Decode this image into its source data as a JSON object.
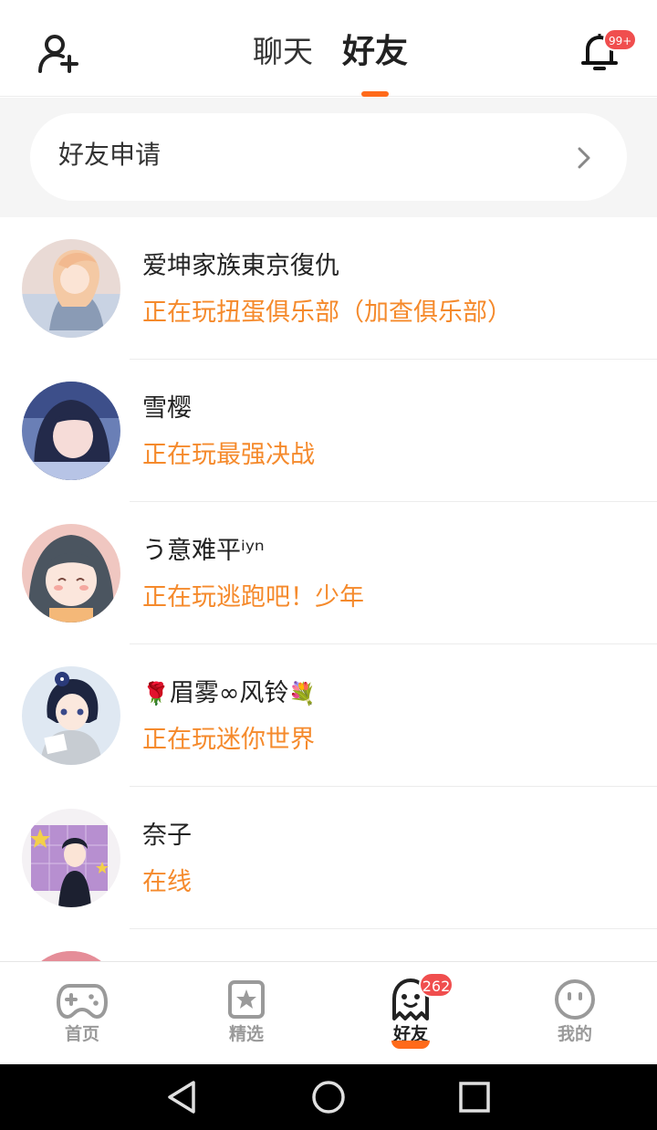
{
  "header": {
    "tabs": [
      {
        "label": "聊天",
        "active": false
      },
      {
        "label": "好友",
        "active": true
      }
    ],
    "notification_badge": "99+",
    "accent_color": "#ff6a1a"
  },
  "friend_request": {
    "label": "好友申请"
  },
  "friends": [
    {
      "name": "爱坤家族東京復仇",
      "status": "正在玩扭蛋俱乐部（加查俱乐部）"
    },
    {
      "name": "雪樱",
      "status": "正在玩最强决战"
    },
    {
      "name": "う意难平ⁱʸⁿ",
      "status": "正在玩逃跑吧！少年"
    },
    {
      "name_prefix_emoji": "🌹",
      "name": "眉雾∞风铃",
      "name_suffix_emoji": "💐",
      "status": "正在玩迷你世界"
    },
    {
      "name": "奈子",
      "status": "在线"
    }
  ],
  "bottom_nav": {
    "items": [
      {
        "label": "首页",
        "icon": "gamepad-icon",
        "active": false
      },
      {
        "label": "精选",
        "icon": "star-bookmark-icon",
        "active": false
      },
      {
        "label": "好友",
        "icon": "ghost-icon",
        "active": true,
        "badge": "262"
      },
      {
        "label": "我的",
        "icon": "face-icon",
        "active": false
      }
    ]
  },
  "system_nav": [
    "back-icon",
    "home-icon",
    "recents-icon"
  ],
  "colors": {
    "status_orange": "#f58a2c",
    "badge_red": "#f04e4e"
  }
}
